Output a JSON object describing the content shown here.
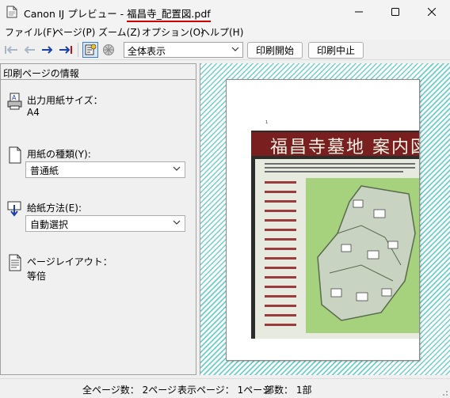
{
  "window": {
    "title_prefix": "Canon IJ プレビュー - ",
    "title_file": "福昌寺_配置図.pdf"
  },
  "menu": [
    "ファイル(F)",
    "ページ(P)",
    "ズーム(Z)",
    "オプション(O)",
    "ヘルプ(H)"
  ],
  "toolbar": {
    "zoom_value": "全体表示",
    "start_print_label": "印刷開始",
    "cancel_print_label": "印刷中止"
  },
  "panel": {
    "header": "印刷ページの情報",
    "paper_size_label": "出力用紙サイズ：",
    "paper_size_value": "A4",
    "media_type_label": "用紙の種類(Y):",
    "media_type_value": "普通紙",
    "paper_source_label": "給紙方法(E):",
    "paper_source_value": "自動選択",
    "page_layout_label": "ページレイアウト：",
    "page_layout_value": "等倍"
  },
  "preview": {
    "page_number": "1",
    "sign_title": "福昌寺墓地 案内図",
    "stripe_color": "#6dcece"
  },
  "status": {
    "total_pages": "全ページ数：  2ページ",
    "current_page": "表示ページ：  1ページ",
    "copies": "部数：  1部"
  }
}
